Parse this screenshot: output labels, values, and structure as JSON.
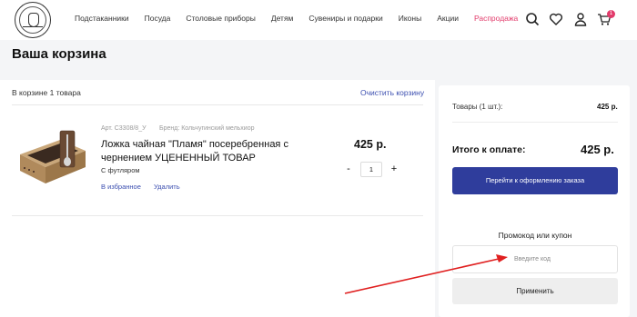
{
  "header": {
    "nav": [
      "Подстаканники",
      "Посуда",
      "Столовые приборы",
      "Детям",
      "Сувениры и подарки",
      "Иконы",
      "Акции",
      "Распродажа"
    ],
    "cart_count": "1"
  },
  "page": {
    "title": "Ваша корзина"
  },
  "cart": {
    "count_text": "В корзине 1 товара",
    "clear_label": "Очистить корзину",
    "item": {
      "article": "Арт. С3308/8_У",
      "brand": "Бренд: Кольчугинский мельхиор",
      "name": "Ложка чайная \"Пламя\" посеребренная с чернением УЦЕНЕННЫЙ ТОВАР",
      "option": "С футляром",
      "favorite_label": "В избранное",
      "delete_label": "Удалить",
      "price": "425 р.",
      "quantity": "1",
      "minus_label": "-",
      "plus_label": "+"
    }
  },
  "summary": {
    "items_label": "Товары (1 шт.):",
    "items_value": "425 р.",
    "total_label": "Итого к оплате:",
    "total_value": "425 р.",
    "checkout_label": "Перейти к оформлению заказа",
    "promo_title": "Промокод или купон",
    "promo_placeholder": "Введите код",
    "apply_label": "Применить"
  },
  "colors": {
    "accent": "#2f3d9c",
    "sale": "#e23b6b",
    "link": "#3c4fb0",
    "annotation_arrow": "#e02020"
  },
  "icons": [
    "logo",
    "search-icon",
    "heart-icon",
    "user-icon",
    "cart-icon"
  ]
}
